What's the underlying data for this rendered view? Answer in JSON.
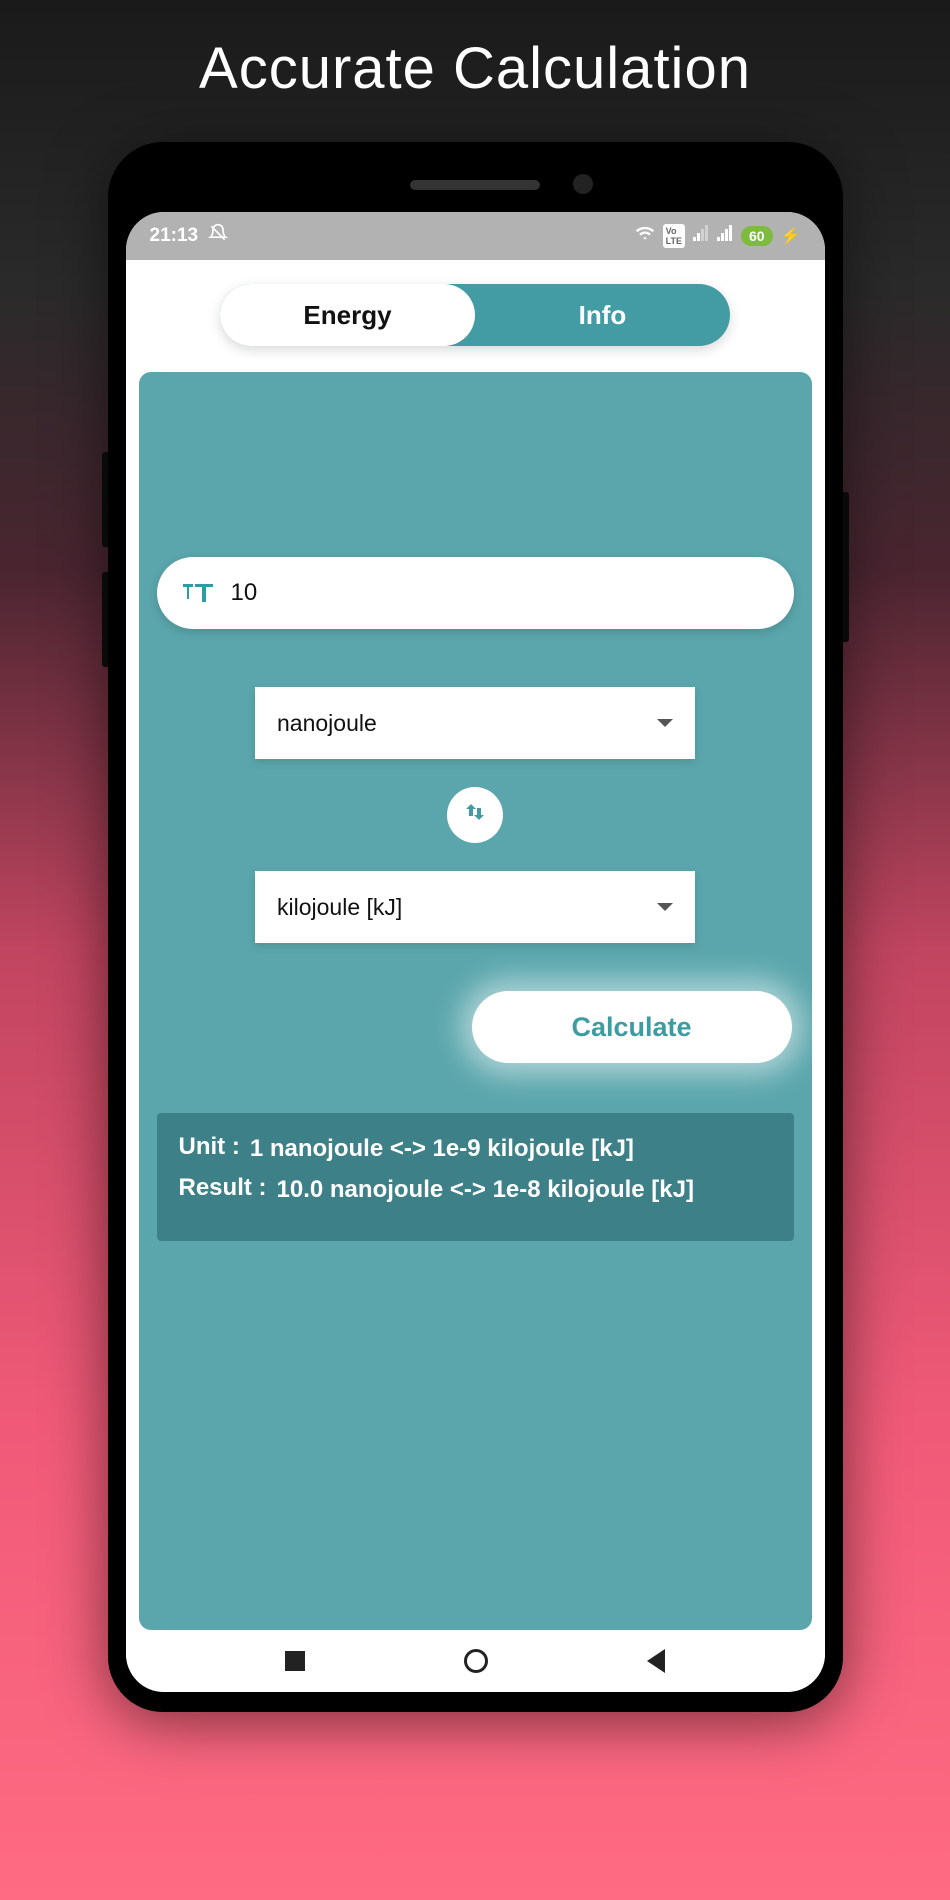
{
  "title": "Accurate Calculation",
  "statusbar": {
    "time": "21:13",
    "battery": "60"
  },
  "tabs": {
    "left": "Energy",
    "right": "Info"
  },
  "input": {
    "value": "10",
    "icon_name": "text-size-icon"
  },
  "from_unit": "nanojoule",
  "to_unit": "kilojoule [kJ]",
  "calculate_label": "Calculate",
  "result": {
    "unit_label": "Unit :",
    "unit_value": "1 nanojoule  <->  1e-9 kilojoule [kJ]",
    "result_label": "Result :",
    "result_value": "10.0 nanojoule  <->  1e-8 kilojoule [kJ]"
  }
}
